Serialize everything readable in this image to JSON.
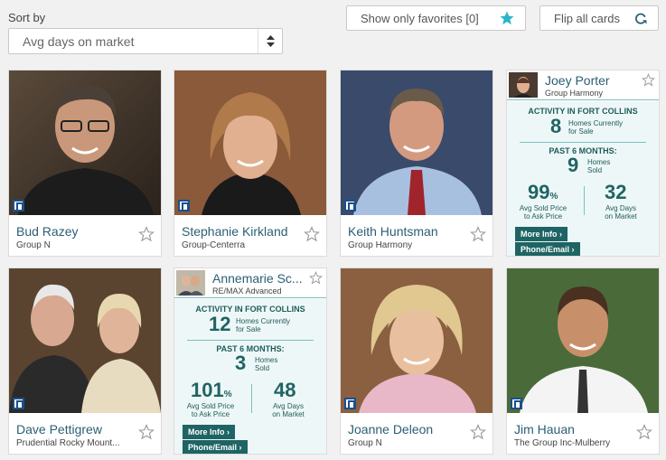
{
  "sort": {
    "label": "Sort by",
    "value": "Avg days on market"
  },
  "favorites_button": {
    "label": "Show only favorites [0]",
    "star_color": "#29b6c9"
  },
  "flip_button": {
    "label": "Flip all cards"
  },
  "cards": [
    {
      "name": "Bud Razey",
      "company": "Group N"
    },
    {
      "name": "Stephanie Kirkland",
      "company": "Group-Centerra"
    },
    {
      "name": "Keith Huntsman",
      "company": "Group Harmony"
    },
    {
      "name": "Joey Porter",
      "company": "Group Harmony",
      "activity_title": "ACTIVITY IN FORT COLLINS",
      "homes_for_sale": "8",
      "homes_for_sale_label_1": "Homes Currently",
      "homes_for_sale_label_2": "for Sale",
      "past_title": "PAST 6 MONTHS:",
      "homes_sold": "9",
      "homes_sold_label_1": "Homes",
      "homes_sold_label_2": "Sold",
      "avg_sold_pct": "99",
      "avg_sold_label_1": "Avg Sold Price",
      "avg_sold_label_2": "to Ask Price",
      "avg_days": "32",
      "avg_days_label_1": "Avg Days",
      "avg_days_label_2": "on Market",
      "more_info": "More Info ›",
      "phone_email": "Phone/Email ›"
    },
    {
      "name": "Dave Pettigrew",
      "company": "Prudential Rocky Mount..."
    },
    {
      "name": "Annemarie Sc...",
      "company": "RE/MAX Advanced",
      "activity_title": "ACTIVITY IN FORT COLLINS",
      "homes_for_sale": "12",
      "homes_for_sale_label_1": "Homes Currently",
      "homes_for_sale_label_2": "for Sale",
      "past_title": "PAST 6 MONTHS:",
      "homes_sold": "3",
      "homes_sold_label_1": "Homes",
      "homes_sold_label_2": "Sold",
      "avg_sold_pct": "101",
      "avg_sold_label_1": "Avg Sold Price",
      "avg_sold_label_2": "to Ask Price",
      "avg_days": "48",
      "avg_days_label_1": "Avg Days",
      "avg_days_label_2": "on Market",
      "more_info": "More Info ›",
      "phone_email": "Phone/Email ›"
    },
    {
      "name": "Joanne Deleon",
      "company": "Group N"
    },
    {
      "name": "Jim Hauan",
      "company": "The Group Inc-Mulberry"
    }
  ],
  "percent_sign": "%"
}
